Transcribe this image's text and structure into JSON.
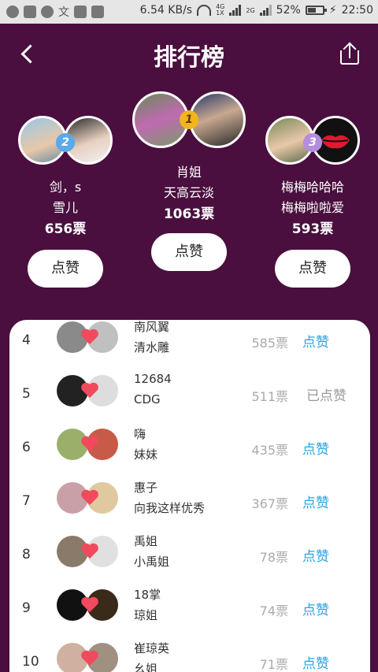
{
  "status_bar": {
    "net_speed": "6.54 KB/s",
    "net_4g_up": "4G",
    "net_4g_down": "1X",
    "net_2g": "2G",
    "battery_pct": "52%",
    "time": "22:50",
    "notif_icons": [
      "settings-icon",
      "lock-icon",
      "chat-icon",
      "wen-icon",
      "activity-icon",
      "image-icon"
    ],
    "wen_glyph": "文"
  },
  "header": {
    "title": "排行榜"
  },
  "podium": {
    "first": {
      "rank": "1",
      "name1": "肖姐",
      "name2": "天高云淡",
      "votes": "1063票",
      "like_label": "点赞",
      "badge_color": "#f2b51c"
    },
    "second": {
      "rank": "2",
      "name1": "剑，s",
      "name2": "雪儿",
      "votes": "656票",
      "like_label": "点赞",
      "badge_color": "#5aa9e8"
    },
    "third": {
      "rank": "3",
      "name1": "梅梅哈哈哈",
      "name2": "梅梅啦啦爱",
      "votes": "593票",
      "like_label": "点赞",
      "badge_color": "#b48de0"
    }
  },
  "list": [
    {
      "rank": "4",
      "name1": "南风翼",
      "name2": "清水雕",
      "votes": "585票",
      "action": "点赞",
      "liked": false
    },
    {
      "rank": "5",
      "name1": "12684",
      "name2": "CDG",
      "votes": "511票",
      "action": "已点赞",
      "liked": true
    },
    {
      "rank": "6",
      "name1": "嗨",
      "name2": "妹妹",
      "votes": "435票",
      "action": "点赞",
      "liked": false
    },
    {
      "rank": "7",
      "name1": "惠子",
      "name2": "向我这样优秀",
      "votes": "367票",
      "action": "点赞",
      "liked": false
    },
    {
      "rank": "8",
      "name1": "禹姐",
      "name2": "小禹姐",
      "votes": "78票",
      "action": "点赞",
      "liked": false
    },
    {
      "rank": "9",
      "name1": "18掌",
      "name2": "琼姐",
      "votes": "74票",
      "action": "点赞",
      "liked": false
    },
    {
      "rank": "10",
      "name1": "崔琼英",
      "name2": "幺姐",
      "votes": "71票",
      "action": "点赞",
      "liked": false
    }
  ],
  "colors": {
    "background": "#4a0f3e",
    "like_blue": "#2aa3e0",
    "liked_gray": "#999999",
    "heart": "#f04a5c"
  }
}
